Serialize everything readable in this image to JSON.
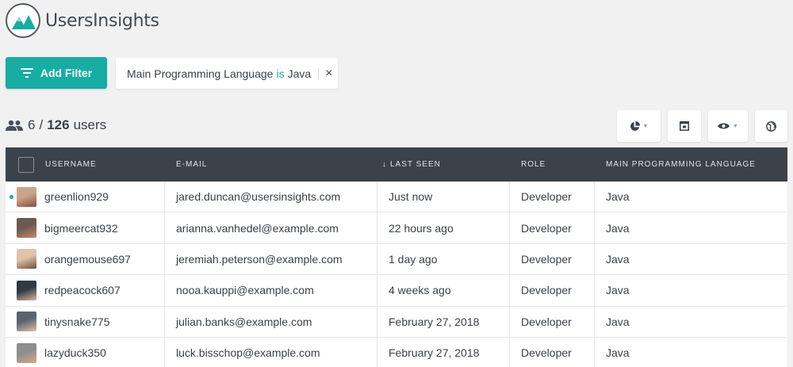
{
  "app": {
    "logo_text": "UsersInsights",
    "accent": "#16aea3"
  },
  "toolbar": {
    "add_filter_label": "Add Filter"
  },
  "filter": {
    "field": "Main Programming Language",
    "operator": "is",
    "value": "Java",
    "remove": "×"
  },
  "count": {
    "shown": "6",
    "slash": "/",
    "total": "126",
    "unit": "users"
  },
  "table": {
    "columns": {
      "username": "Username",
      "email": "E-mail",
      "last_seen_arrow": "↓",
      "last_seen": "Last Seen",
      "role": "Role",
      "language": "Main Programming Language"
    },
    "rows": [
      {
        "username": "greenlion929",
        "email": "jared.duncan@usersinsights.com",
        "last_seen": "Just now",
        "role": "Developer",
        "language": "Java"
      },
      {
        "username": "bigmeercat932",
        "email": "arianna.vanhedel@example.com",
        "last_seen": "22 hours ago",
        "role": "Developer",
        "language": "Java"
      },
      {
        "username": "orangemouse697",
        "email": "jeremiah.peterson@example.com",
        "last_seen": "1 day ago",
        "role": "Developer",
        "language": "Java"
      },
      {
        "username": "redpeacock607",
        "email": "nooa.kauppi@example.com",
        "last_seen": "4 weeks ago",
        "role": "Developer",
        "language": "Java"
      },
      {
        "username": "tinysnake775",
        "email": "julian.banks@example.com",
        "last_seen": "February 27, 2018",
        "role": "Developer",
        "language": "Java"
      },
      {
        "username": "lazyduck350",
        "email": "luck.bisschop@example.com",
        "last_seen": "February 27, 2018",
        "role": "Developer",
        "language": "Java"
      }
    ]
  }
}
